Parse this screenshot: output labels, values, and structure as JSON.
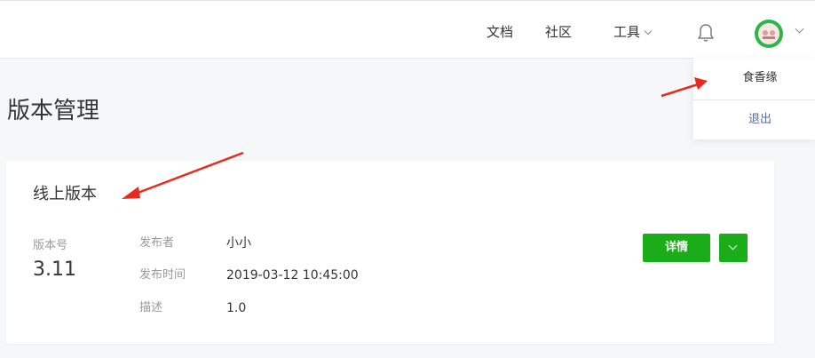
{
  "nav": {
    "docs": "文档",
    "community": "社区",
    "tools": "工具"
  },
  "user_menu": {
    "username": "食香缘",
    "logout": "退出"
  },
  "page": {
    "title": "版本管理"
  },
  "card": {
    "title": "线上版本",
    "version_label": "版本号",
    "version_value": "3.11",
    "publisher_label": "发布者",
    "publisher_value": "小小",
    "time_label": "发布时间",
    "time_value": "2019-03-12 10:45:00",
    "desc_label": "描述",
    "desc_value": "1.0",
    "detail_button": "详情"
  },
  "colors": {
    "accent": "#1aad19",
    "link": "#576b95",
    "annotation_arrow": "#e8291c"
  },
  "icons": {
    "bell": "bell-icon",
    "avatar": "avatar",
    "chevron": "chevron-down-icon"
  }
}
